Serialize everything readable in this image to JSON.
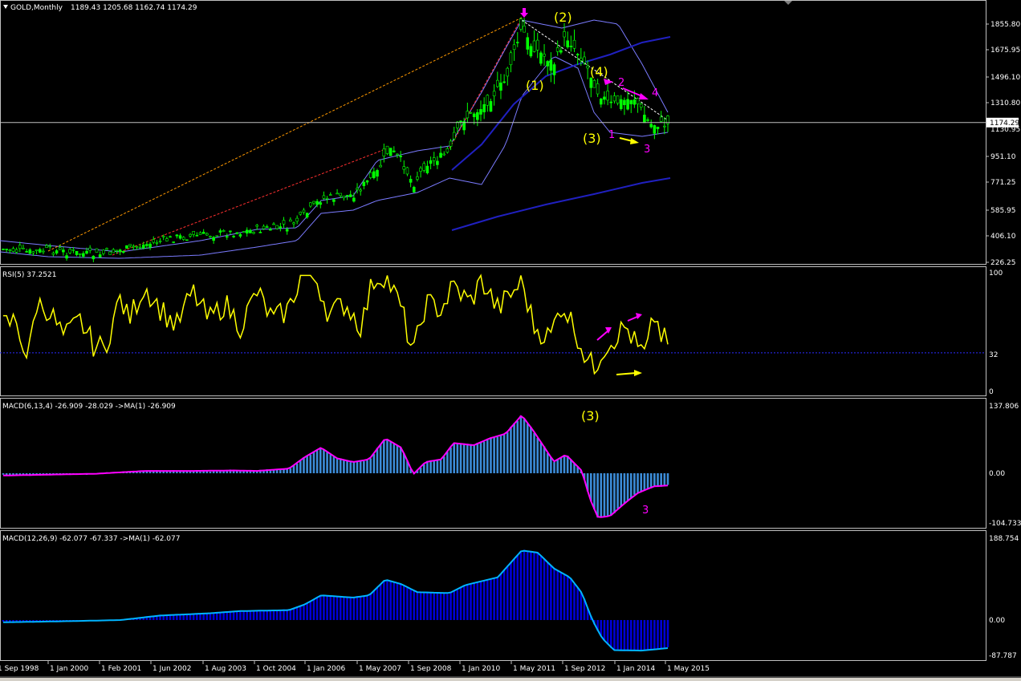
{
  "colors": {
    "background": "#000000",
    "frame": "#c0c0c0",
    "bull_candle": "#00ff00",
    "bear_candle": "#00ff00",
    "bands": "#7b7bff",
    "ma": "#2020c0",
    "rsi": "#ffff00",
    "macd_fast_hist": "#3c8cd8",
    "macd_fast_signal": "#ff00ff",
    "macd_slow_hist": "#0000d8",
    "macd_slow_signal": "#00b4ff",
    "price_line": "#c0c0c0",
    "price_tag_bg": "#ffffff",
    "wave_yellow": "#ffff00",
    "wave_magenta": "#ff00ff"
  },
  "icons": {
    "menu": "triangle-down-icon",
    "top_marker": "triangle-down-gray-icon"
  },
  "header": {
    "symbol": "GOLD,Monthly",
    "ohlc": "1189.43 1205.68 1162.74 1174.29"
  },
  "price_panel": {
    "axis_ticks": [
      "1855.80",
      "1675.95",
      "1496.10",
      "1310.80",
      "1130.95",
      "951.10",
      "771.25",
      "585.95",
      "406.10",
      "226.25"
    ],
    "current_price": "1174.29",
    "wave_labels": [
      "(1)",
      "(2)",
      "(3)",
      "(4)"
    ],
    "sub_wave_labels": [
      "1",
      "2",
      "3",
      "4"
    ]
  },
  "rsi_panel": {
    "title": "RSI(5) 37.2521",
    "axis_ticks": [
      "100",
      "32",
      "0"
    ]
  },
  "macd1_panel": {
    "title": "MACD(6,13,4) -26.909 -28.029  ->MA(1) -26.909",
    "axis_ticks": [
      "137.806",
      "0.00",
      "-104.733"
    ],
    "wave_labels": [
      "(3)",
      "3"
    ]
  },
  "macd2_panel": {
    "title": "MACD(12,26,9) -62.077 -67.337  ->MA(1) -62.077",
    "axis_ticks": [
      "188.754",
      "0.00",
      "-87.787"
    ]
  },
  "time_axis": {
    "labels": [
      "1 Sep 1998",
      "1 Jan 2000",
      "1 Feb 2001",
      "1 Jun 2002",
      "1 Aug 2003",
      "1 Oct 2004",
      "1 Jan 2006",
      "1 May 2007",
      "1 Sep 2008",
      "1 Jan 2010",
      "1 May 2011",
      "1 Sep 2012",
      "1 Jan 2014",
      "1 May 2015"
    ]
  },
  "chart_data": {
    "type": "line",
    "title": "GOLD,Monthly",
    "x": [
      "1 Sep 1998",
      "1 Jan 2000",
      "1 Feb 2001",
      "1 Jun 2002",
      "1 Aug 2003",
      "1 Oct 2004",
      "1 Jan 2006",
      "1 May 2007",
      "1 Sep 2008",
      "1 Jan 2010",
      "1 May 2011",
      "1 Sep 2012",
      "1 Jan 2014",
      "1 May 2015"
    ],
    "ylim": [
      226.25,
      1900
    ],
    "grid": false,
    "series": [
      {
        "name": "",
        "values": [
          290,
          285,
          265,
          320,
          370,
          425,
          550,
          680,
          830,
          1100,
          1550,
          1700,
          1240,
          1174.29
        ]
      }
    ]
  }
}
